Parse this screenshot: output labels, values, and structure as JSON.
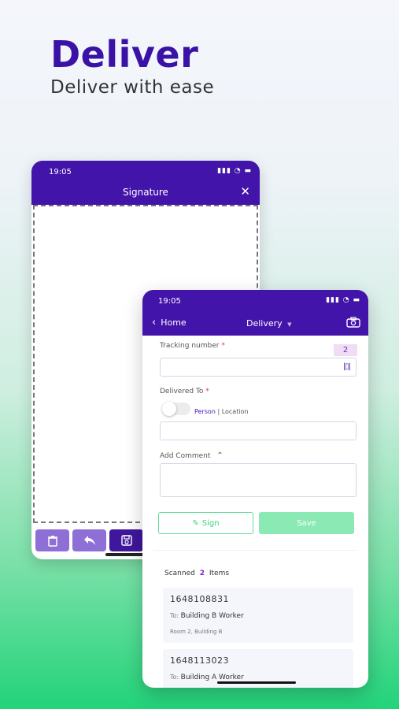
{
  "hero": {
    "title": "Deliver",
    "subtitle": "Deliver with ease"
  },
  "signature_screen": {
    "status_time": "19:05",
    "title": "Signature",
    "close_glyph": "✕",
    "toolbar": [
      "trash-icon",
      "undo-icon",
      "save-icon"
    ]
  },
  "delivery_screen": {
    "status_time": "19:05",
    "back_label": "Home",
    "title": "Delivery",
    "tracking_label": "Tracking number",
    "required_mark": "*",
    "tracking_count": "2",
    "tracking_value": "",
    "delivered_to_label": "Delivered To",
    "toggle_person": "Person",
    "toggle_separator": "|",
    "toggle_location": "Location",
    "delivered_to_value": "",
    "comment_label": "Add Comment",
    "comment_value": "",
    "sign_label": "Sign",
    "save_label": "Save",
    "scanned_prefix": "Scanned",
    "scanned_count": "2",
    "scanned_suffix": "Items",
    "items": [
      {
        "id": "1648108831",
        "to_prefix": "To:",
        "to": "Building B Worker",
        "address": "Room 2, Building B"
      },
      {
        "id": "1648113023",
        "to_prefix": "To:",
        "to": "Building A Worker",
        "address": ""
      }
    ]
  },
  "colors": {
    "brand_purple": "#4314a9",
    "accent_green": "#3fcf84"
  }
}
